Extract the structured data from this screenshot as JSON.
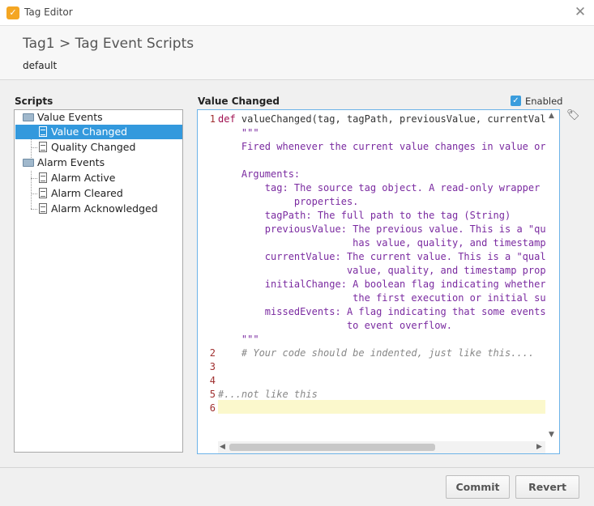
{
  "window": {
    "title": "Tag Editor",
    "close_glyph": "✕"
  },
  "header": {
    "breadcrumb": "Tag1 > Tag Event Scripts",
    "subtitle": "default"
  },
  "scripts_panel": {
    "label": "Scripts",
    "tree": [
      {
        "label": "Value Events",
        "icon": "folder-open-icon"
      },
      {
        "label": "Value Changed",
        "icon": "script-icon",
        "selected": true
      },
      {
        "label": "Quality Changed",
        "icon": "script-icon"
      },
      {
        "label": "Alarm Events",
        "icon": "folder-open-icon"
      },
      {
        "label": "Alarm Active",
        "icon": "script-icon"
      },
      {
        "label": "Alarm Cleared",
        "icon": "script-icon"
      },
      {
        "label": "Alarm Acknowledged",
        "icon": "script-icon"
      }
    ]
  },
  "editor": {
    "label": "Value Changed",
    "enabled_label": "Enabled",
    "enabled": true,
    "lines": [
      {
        "no": "1",
        "kw": "def",
        "text": " valueChanged(tag, tagPath, previousValue, currentValue"
      },
      {
        "no": "",
        "text": "    \"\"\""
      },
      {
        "no": "",
        "text": "    Fired whenever the current value changes in value or q"
      },
      {
        "no": "",
        "text": ""
      },
      {
        "no": "",
        "text": "    Arguments:"
      },
      {
        "no": "",
        "text": "        tag: The source tag object. A read-only wrapper fo"
      },
      {
        "no": "",
        "text": "             properties."
      },
      {
        "no": "",
        "text": "        tagPath: The full path to the tag (String)"
      },
      {
        "no": "",
        "text": "        previousValue: The previous value. This is a \"qual"
      },
      {
        "no": "",
        "text": "                       has value, quality, and timestamp p"
      },
      {
        "no": "",
        "text": "        currentValue: The current value. This is a \"qualif"
      },
      {
        "no": "",
        "text": "                      value, quality, and timestamp proper"
      },
      {
        "no": "",
        "text": "        initialChange: A boolean flag indicating whether t"
      },
      {
        "no": "",
        "text": "                       the first execution or initial subs"
      },
      {
        "no": "",
        "text": "        missedEvents: A flag indicating that some events h"
      },
      {
        "no": "",
        "text": "                      to event overflow."
      },
      {
        "no": "",
        "text": "    \"\"\""
      },
      {
        "no": "2",
        "text": "    # Your code should be indented, just like this....",
        "comment": true
      },
      {
        "no": "3",
        "text": ""
      },
      {
        "no": "4",
        "text": ""
      },
      {
        "no": "5",
        "text": "#...not like this",
        "comment": true
      },
      {
        "no": "6",
        "text": ""
      }
    ]
  },
  "footer": {
    "commit_label": "Commit",
    "revert_label": "Revert"
  },
  "colors": {
    "accent": "#3399dd",
    "docstring": "#7a2aa0",
    "keyword": "#a01050",
    "current_line": "#fbf8cc"
  }
}
